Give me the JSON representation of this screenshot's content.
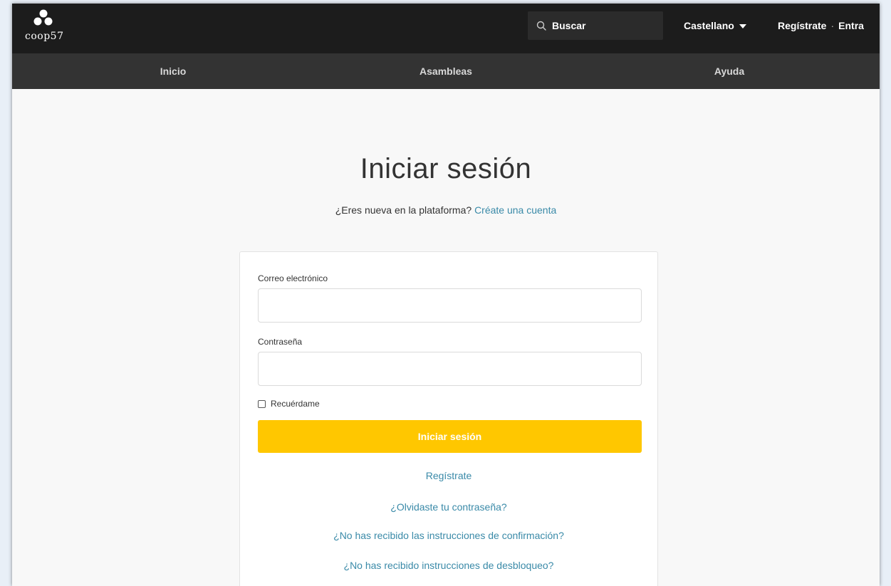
{
  "header": {
    "logo_text": "coop57",
    "search_placeholder": "Buscar",
    "language": "Castellano",
    "register_link": "Regístrate",
    "separator": "·",
    "login_link": "Entra"
  },
  "nav": {
    "items": [
      "Inicio",
      "Asambleas",
      "Ayuda"
    ]
  },
  "main": {
    "title": "Iniciar sesión",
    "subtitle_text": "¿Eres nueva en la plataforma?",
    "subtitle_link": "Créate una cuenta"
  },
  "form": {
    "email_label": "Correo electrónico",
    "email_value": "",
    "password_label": "Contraseña",
    "password_value": "",
    "remember_label": "Recuérdame",
    "remember_checked": false,
    "submit_label": "Iniciar sesión"
  },
  "links": {
    "register": "Regístrate",
    "forgot_password": "¿Olvidaste tu contraseña?",
    "no_confirmation": "¿No has recibido las instrucciones de confirmación?",
    "no_unlock": "¿No has recibido instrucciones de desbloqueo?"
  },
  "colors": {
    "topbar_bg": "#1c1c1c",
    "navbar_bg": "#333333",
    "accent_button": "#ffc700",
    "link": "#3a8aa8"
  },
  "icons": {
    "search": "search-icon",
    "language_caret": "caret-down-icon",
    "logo": "coop57-logo-icon"
  }
}
